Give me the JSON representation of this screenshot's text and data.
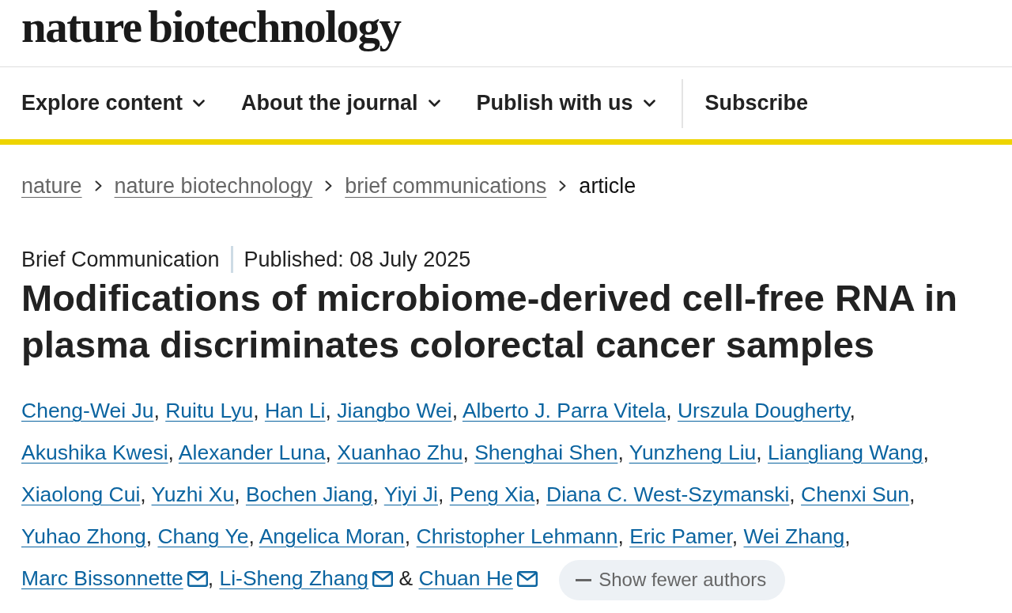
{
  "header": {
    "logo": "nature biotechnology"
  },
  "nav": {
    "items": [
      {
        "label": "Explore content",
        "kind": "menu"
      },
      {
        "label": "About the journal",
        "kind": "menu"
      },
      {
        "label": "Publish with us",
        "kind": "menu"
      },
      {
        "label": "Subscribe",
        "kind": "link"
      }
    ]
  },
  "breadcrumbs": [
    {
      "label": "nature",
      "current": false
    },
    {
      "label": "nature biotechnology",
      "current": false
    },
    {
      "label": "brief communications",
      "current": false
    },
    {
      "label": "article",
      "current": true
    }
  ],
  "article": {
    "type": "Brief Communication",
    "published": "Published: 08 July 2025",
    "title": "Modifications of microbiome-derived cell-free RNA in plasma discriminates colorectal cancer samples",
    "authors": [
      {
        "name": "Cheng-Wei Ju",
        "email": false,
        "separator": ","
      },
      {
        "name": "Ruitu Lyu",
        "email": false,
        "separator": ","
      },
      {
        "name": "Han Li",
        "email": false,
        "separator": ","
      },
      {
        "name": "Jiangbo Wei",
        "email": false,
        "separator": ","
      },
      {
        "name": "Alberto J. Parra Vitela",
        "email": false,
        "separator": ","
      },
      {
        "name": "Urszula Dougherty",
        "email": false,
        "separator": ","
      },
      {
        "name": "Akushika Kwesi",
        "email": false,
        "separator": ","
      },
      {
        "name": "Alexander Luna",
        "email": false,
        "separator": ","
      },
      {
        "name": "Xuanhao Zhu",
        "email": false,
        "separator": ","
      },
      {
        "name": "Shenghai Shen",
        "email": false,
        "separator": ","
      },
      {
        "name": "Yunzheng Liu",
        "email": false,
        "separator": ","
      },
      {
        "name": "Liangliang Wang",
        "email": false,
        "separator": ","
      },
      {
        "name": "Xiaolong Cui",
        "email": false,
        "separator": ","
      },
      {
        "name": "Yuzhi Xu",
        "email": false,
        "separator": ","
      },
      {
        "name": "Bochen Jiang",
        "email": false,
        "separator": ","
      },
      {
        "name": "Yiyi Ji",
        "email": false,
        "separator": ","
      },
      {
        "name": "Peng Xia",
        "email": false,
        "separator": ","
      },
      {
        "name": "Diana C. West-Szymanski",
        "email": false,
        "separator": ","
      },
      {
        "name": "Chenxi Sun",
        "email": false,
        "separator": ","
      },
      {
        "name": "Yuhao Zhong",
        "email": false,
        "separator": ","
      },
      {
        "name": "Chang Ye",
        "email": false,
        "separator": ","
      },
      {
        "name": "Angelica Moran",
        "email": false,
        "separator": ","
      },
      {
        "name": "Christopher Lehmann",
        "email": false,
        "separator": ","
      },
      {
        "name": "Eric Pamer",
        "email": false,
        "separator": ","
      },
      {
        "name": "Wei Zhang",
        "email": false,
        "separator": ","
      },
      {
        "name": "Marc Bissonnette",
        "email": true,
        "separator": ","
      },
      {
        "name": "Li-Sheng Zhang",
        "email": true,
        "separator": " &"
      },
      {
        "name": "Chuan He",
        "email": true
      }
    ],
    "toggle_button": "Show fewer authors"
  }
}
